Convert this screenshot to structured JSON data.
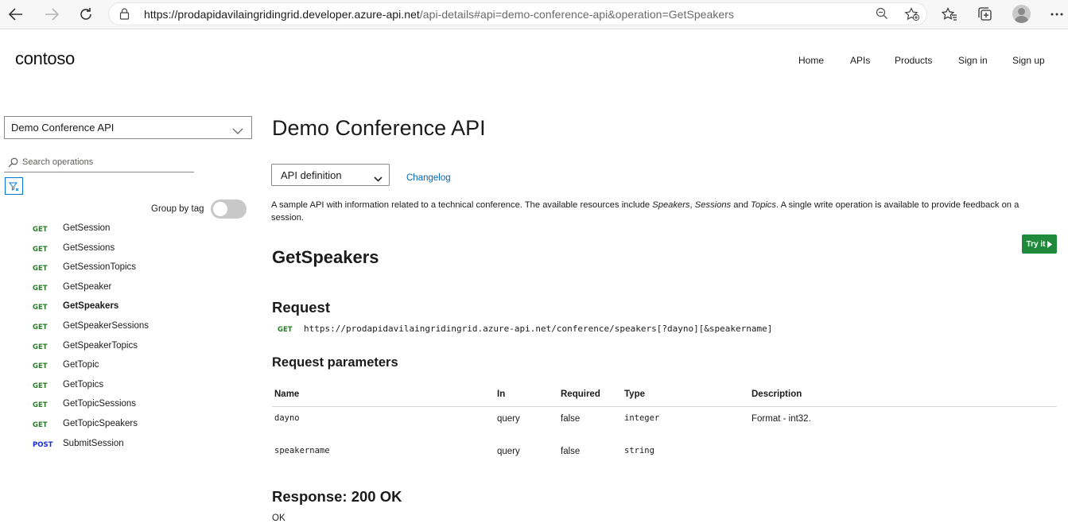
{
  "browser": {
    "url_host": "https://prodapidavilaingridingrid.developer.azure-api.net",
    "url_path": "/api-details#api=demo-conference-api&operation=GetSpeakers",
    "icons": [
      "back-arrow-icon",
      "forward-arrow-icon",
      "refresh-icon",
      "lock-icon",
      "zoom-icon",
      "add-favorite-icon",
      "favorites-icon",
      "collections-icon",
      "profile-icon",
      "more-icon"
    ]
  },
  "site": {
    "logo": "contoso",
    "nav": [
      "Home",
      "APIs",
      "Products",
      "Sign in",
      "Sign up"
    ]
  },
  "sidebar": {
    "api_select": "Demo Conference API",
    "search_placeholder": "Search operations",
    "group_by_tag_label": "Group by tag",
    "group_by_tag_on": false,
    "operations": [
      {
        "method": "GET",
        "name": "GetSession"
      },
      {
        "method": "GET",
        "name": "GetSessions"
      },
      {
        "method": "GET",
        "name": "GetSessionTopics"
      },
      {
        "method": "GET",
        "name": "GetSpeaker"
      },
      {
        "method": "GET",
        "name": "GetSpeakers"
      },
      {
        "method": "GET",
        "name": "GetSpeakerSessions"
      },
      {
        "method": "GET",
        "name": "GetSpeakerTopics"
      },
      {
        "method": "GET",
        "name": "GetTopic"
      },
      {
        "method": "GET",
        "name": "GetTopics"
      },
      {
        "method": "GET",
        "name": "GetTopicSessions"
      },
      {
        "method": "GET",
        "name": "GetTopicSpeakers"
      },
      {
        "method": "POST",
        "name": "SubmitSession"
      }
    ],
    "active_operation": "GetSpeakers"
  },
  "main": {
    "api_title": "Demo Conference API",
    "definition_select": "API definition",
    "changelog": "Changelog",
    "description": {
      "p1": "A sample API with information related to a technical conference. The available resources include ",
      "e1": "Speakers",
      "p2": ", ",
      "e2": "Sessions",
      "p3": " and ",
      "e3": "Topics",
      "p4": ". A single write operation is available to provide feedback on a session."
    },
    "try_it": "Try it",
    "operation_title": "GetSpeakers",
    "request_heading": "Request",
    "request_method": "GET",
    "request_url": "https://prodapidavilaingridingrid.azure-api.net/conference/speakers[?dayno][&speakername]",
    "params_heading": "Request parameters",
    "params_columns": [
      "Name",
      "In",
      "Required",
      "Type",
      "Description"
    ],
    "params": [
      {
        "name": "dayno",
        "in": "query",
        "required": "false",
        "type": "integer",
        "description": "Format - int32."
      },
      {
        "name": "speakername",
        "in": "query",
        "required": "false",
        "type": "string",
        "description": ""
      }
    ],
    "response_heading": "Response: 200 OK",
    "response_desc": "OK"
  },
  "colors": {
    "get_method": "#2a7a2a",
    "post_method": "#1a2bd8",
    "link": "#0068b8",
    "try_it_bg": "#1f8a3b"
  }
}
